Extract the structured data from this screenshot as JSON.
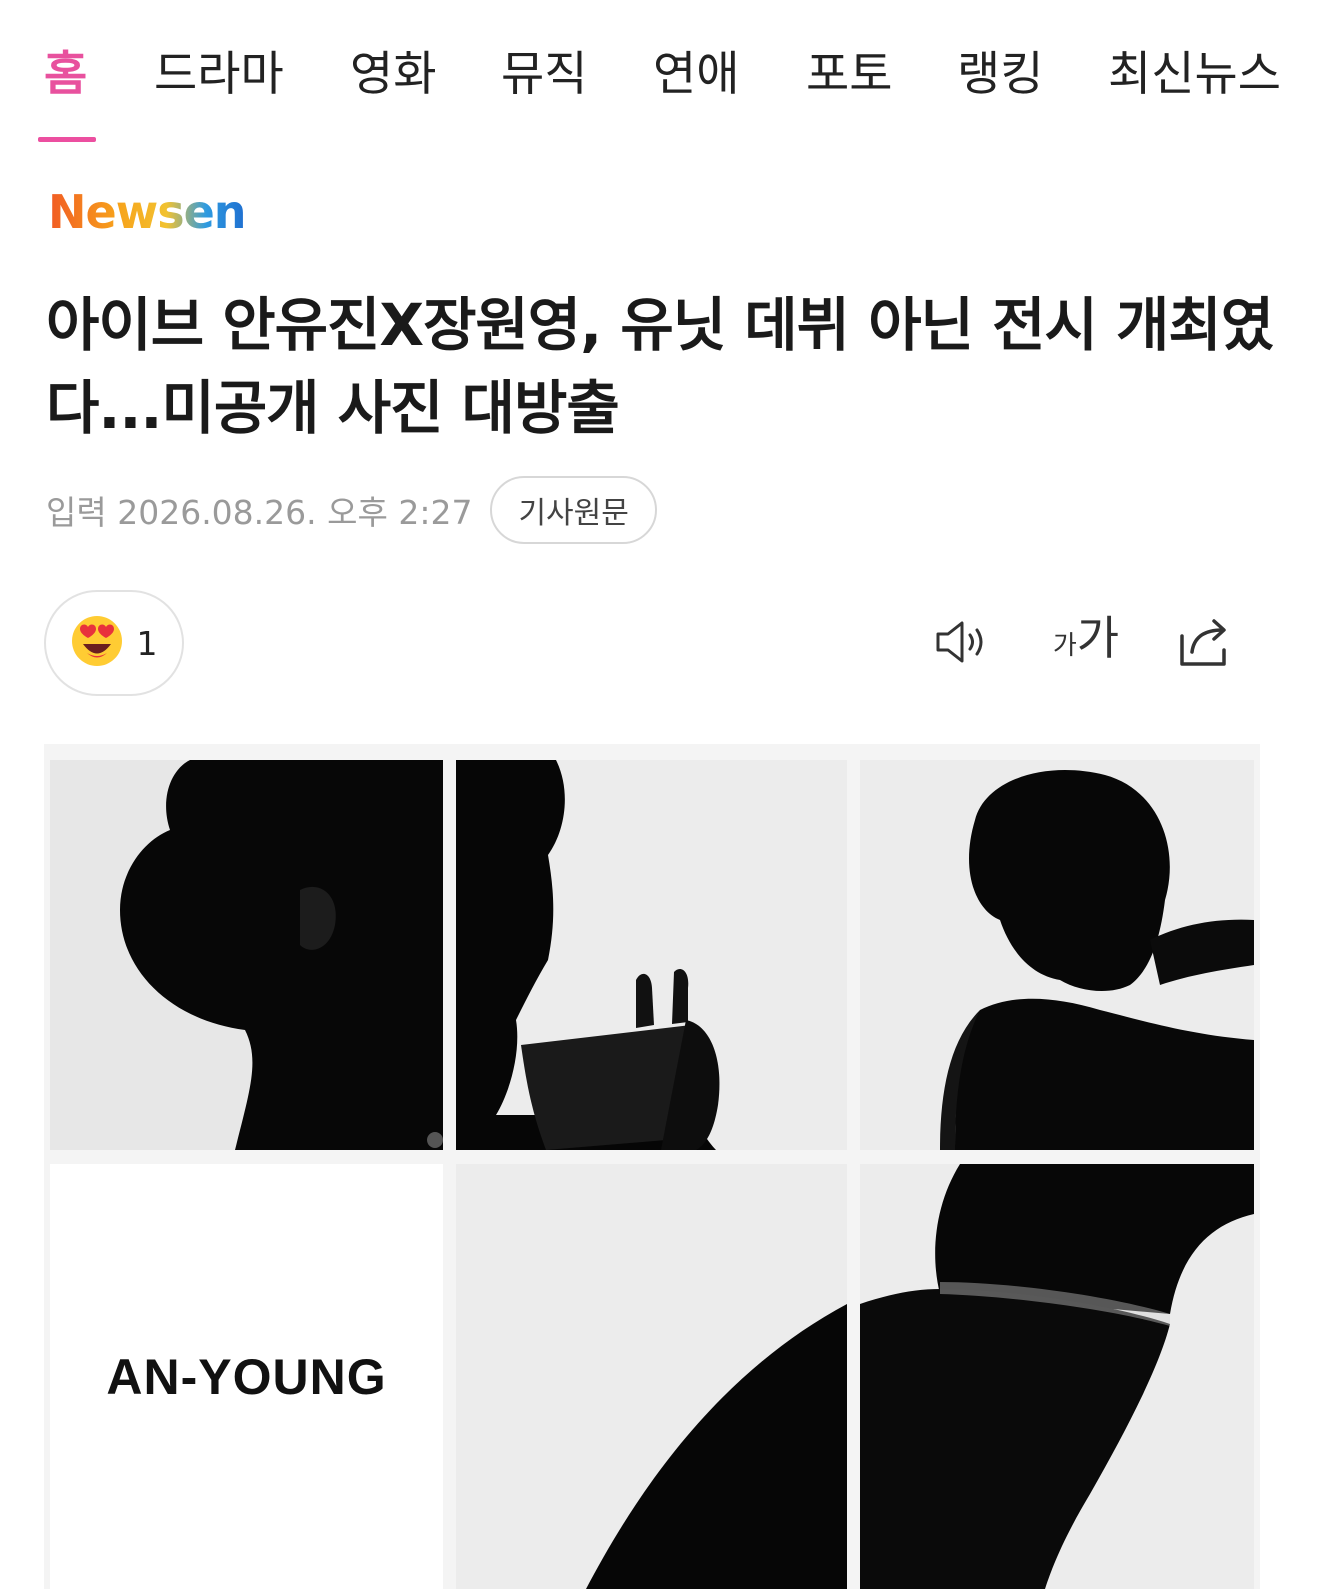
{
  "nav": {
    "tabs": [
      {
        "label": "홈",
        "active": true
      },
      {
        "label": "드라마",
        "active": false
      },
      {
        "label": "영화",
        "active": false
      },
      {
        "label": "뮤직",
        "active": false
      },
      {
        "label": "연애",
        "active": false
      },
      {
        "label": "포토",
        "active": false
      },
      {
        "label": "랭킹",
        "active": false
      },
      {
        "label": "최신뉴스",
        "active": false
      }
    ],
    "accent_color": "#ec4fa0"
  },
  "publisher": {
    "logo_text": "Newsen"
  },
  "article": {
    "headline": "아이브 안유진X장원영, 유닛 데뷔 아닌 전시 개최였다...미공개 사진 대방출",
    "date_text": "입력 2026.08.26. 오후 2:27",
    "source_button_label": "기사원문"
  },
  "reaction": {
    "icon": "heart-eyes-emoji-icon",
    "count": "1"
  },
  "toolbar": {
    "audio_icon": "speaker-icon",
    "font_size_label_small": "가",
    "font_size_label_large": "가",
    "share_icon": "share-icon"
  },
  "photo": {
    "caption_text": "AN-YOUNG"
  }
}
